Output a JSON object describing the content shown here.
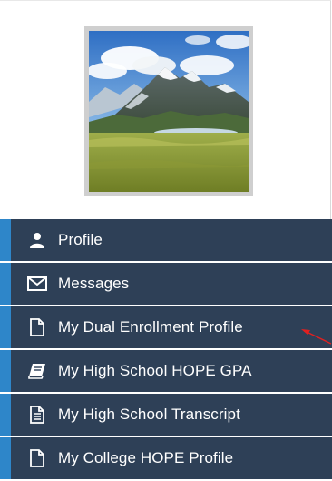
{
  "profile_card": {
    "image_icon": "mountain-landscape-avatar"
  },
  "menu": {
    "items": [
      {
        "label": "Profile",
        "icon": "user-icon"
      },
      {
        "label": "Messages",
        "icon": "envelope-icon"
      },
      {
        "label": "My Dual Enrollment Profile",
        "icon": "document-icon"
      },
      {
        "label": "My High School HOPE GPA",
        "icon": "book-icon"
      },
      {
        "label": "My High School Transcript",
        "icon": "document-lines-icon"
      },
      {
        "label": "My College HOPE Profile",
        "icon": "document-icon"
      }
    ]
  },
  "colors": {
    "menu_bg": "#2e4057",
    "menu_accent": "#2e86c9",
    "menu_text": "#ffffff",
    "annotation_arrow": "#e02020"
  }
}
